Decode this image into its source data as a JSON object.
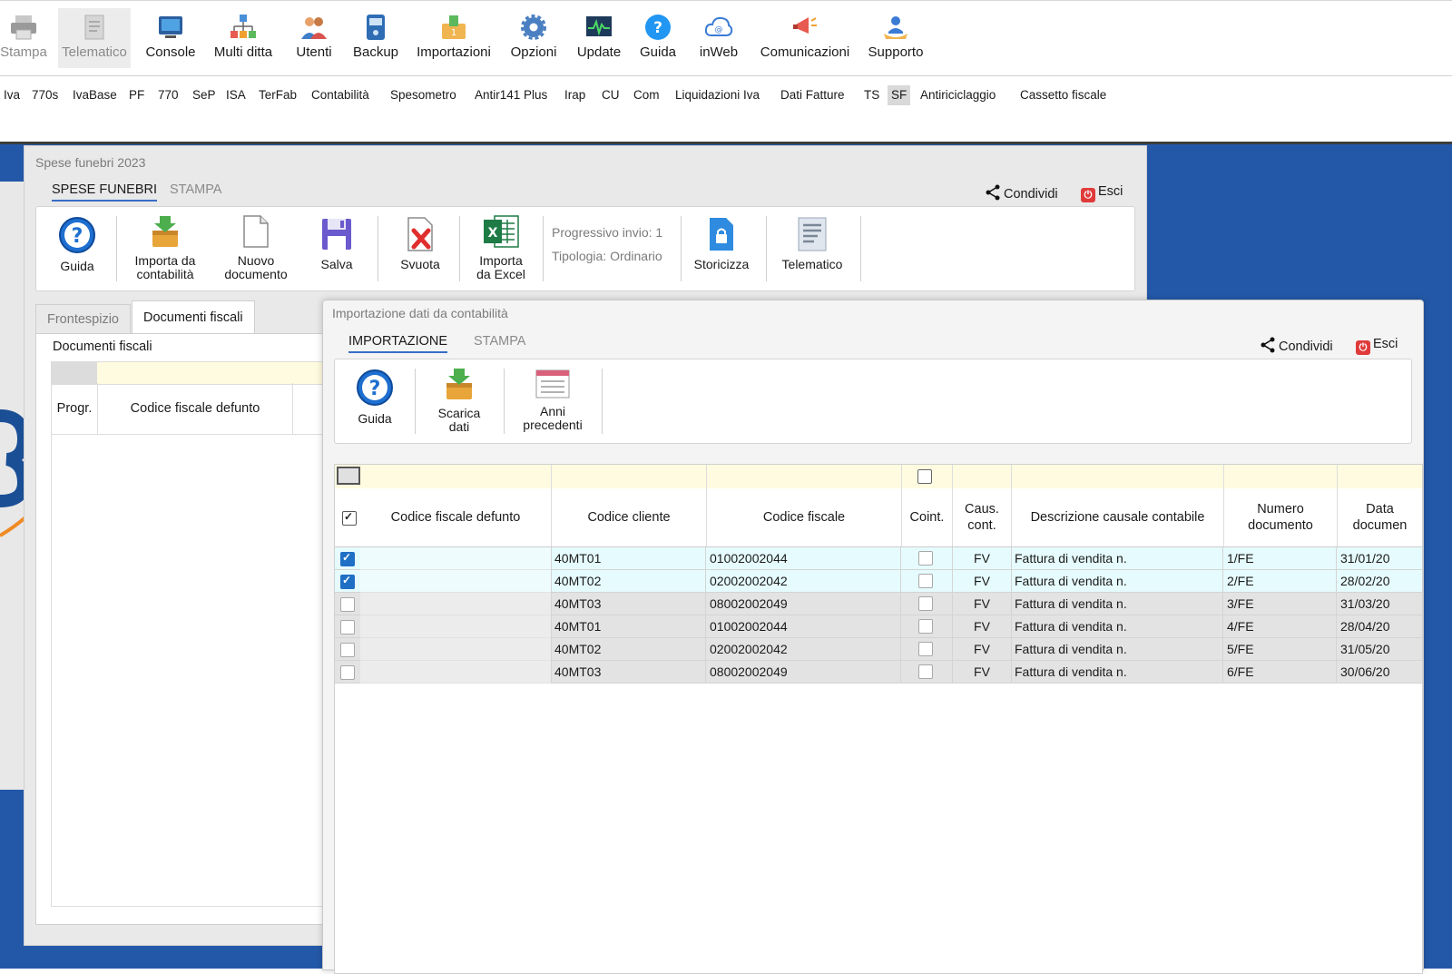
{
  "ribbon": {
    "items": [
      {
        "label": "Stampa",
        "icon": "printer-icon",
        "state": "disabled"
      },
      {
        "label": "Telematico",
        "icon": "telematico-icon",
        "state": "disabled-selected"
      },
      {
        "label": "Console",
        "icon": "console-icon",
        "state": "normal"
      },
      {
        "label": "Multi ditta",
        "icon": "multi-company-icon",
        "state": "normal"
      },
      {
        "label": "Utenti",
        "icon": "users-icon",
        "state": "normal"
      },
      {
        "label": "Backup",
        "icon": "backup-icon",
        "state": "normal"
      },
      {
        "label": "Importazioni",
        "icon": "import-icon",
        "state": "normal"
      },
      {
        "label": "Opzioni",
        "icon": "gear-icon",
        "state": "normal"
      },
      {
        "label": "Update",
        "icon": "update-icon",
        "state": "normal"
      },
      {
        "label": "Guida",
        "icon": "help-icon",
        "state": "normal"
      },
      {
        "label": "inWeb",
        "icon": "cloud-icon",
        "state": "normal"
      },
      {
        "label": "Comunicazioni",
        "icon": "megaphone-icon",
        "state": "normal"
      },
      {
        "label": "Supporto",
        "icon": "support-icon",
        "state": "normal"
      }
    ]
  },
  "modules": {
    "tabs": [
      "Iva",
      "770s",
      "IvaBase",
      "PF",
      "770",
      "SeP",
      "ISA",
      "TerFab",
      "Contabilità",
      "Spesometro",
      "Antir141 Plus",
      "Irap",
      "CU",
      "Com",
      "Liquidazioni Iva",
      "Dati Fatture",
      "TS",
      "SF",
      "Antiriciclaggio",
      "Cassetto fiscale"
    ],
    "active": "SF"
  },
  "win1": {
    "title": "Spese funebri 2023",
    "tabs": [
      "SPESE FUNEBRI",
      "STAMPA"
    ],
    "share_label": "Condividi",
    "exit_label": "Esci",
    "toolbar": {
      "guida": "Guida",
      "importa_contabilita_1": "Importa da",
      "importa_contabilita_2": "contabilità",
      "nuovo_documento_1": "Nuovo",
      "nuovo_documento_2": "documento",
      "salva": "Salva",
      "svuota": "Svuota",
      "importa_excel_1": "Importa",
      "importa_excel_2": "da Excel",
      "progressivo": "Progressivo invio: 1",
      "tipologia": "Tipologia: Ordinario",
      "storicizza": "Storicizza",
      "telematico": "Telematico"
    },
    "inner_tabs": [
      "Frontespizio",
      "Documenti fiscali"
    ],
    "section_title": "Documenti fiscali",
    "columns": [
      "Progr.",
      "Codice fiscale defunto"
    ]
  },
  "win2": {
    "title": "Importazione dati da contabilità",
    "tabs": [
      "IMPORTAZIONE",
      "STAMPA"
    ],
    "share_label": "Condividi",
    "exit_label": "Esci",
    "toolbar": {
      "guida": "Guida",
      "scarica_1": "Scarica",
      "scarica_2": "dati",
      "anni_1": "Anni",
      "anni_2": "precedenti"
    },
    "columns": {
      "cf_defunto": "Codice fiscale defunto",
      "codice_cliente": "Codice cliente",
      "codice_fiscale": "Codice fiscale",
      "coint": "Coint.",
      "caus_1": "Caus.",
      "caus_2": "cont.",
      "descrizione": "Descrizione causale contabile",
      "numero_1": "Numero",
      "numero_2": "documento",
      "data_1": "Data",
      "data_2": "documen"
    },
    "rows": [
      {
        "checked": true,
        "cliente": "40MT01",
        "cf": "01002002044",
        "caus": "FV",
        "descr": "Fattura di vendita n.",
        "numero": "1/FE",
        "data": "31/01/20"
      },
      {
        "checked": true,
        "cliente": "40MT02",
        "cf": "02002002042",
        "caus": "FV",
        "descr": "Fattura di vendita n.",
        "numero": "2/FE",
        "data": "28/02/20"
      },
      {
        "checked": false,
        "cliente": "40MT03",
        "cf": "08002002049",
        "caus": "FV",
        "descr": "Fattura di vendita n.",
        "numero": "3/FE",
        "data": "31/03/20"
      },
      {
        "checked": false,
        "cliente": "40MT01",
        "cf": "01002002044",
        "caus": "FV",
        "descr": "Fattura di vendita n.",
        "numero": "4/FE",
        "data": "28/04/20"
      },
      {
        "checked": false,
        "cliente": "40MT02",
        "cf": "02002002042",
        "caus": "FV",
        "descr": "Fattura di vendita n.",
        "numero": "5/FE",
        "data": "31/05/20"
      },
      {
        "checked": false,
        "cliente": "40MT03",
        "cf": "08002002049",
        "caus": "FV",
        "descr": "Fattura di vendita n.",
        "numero": "6/FE",
        "data": "30/06/20"
      }
    ]
  },
  "colors": {
    "desktop_blue": "#2358a8",
    "accent_blue": "#3a6dc7",
    "filter_row_yellow": "#fffbe0",
    "selected_row": "#e6fbfd",
    "unselected_row": "#e3e3e3",
    "exit_red": "#e03a3a"
  }
}
